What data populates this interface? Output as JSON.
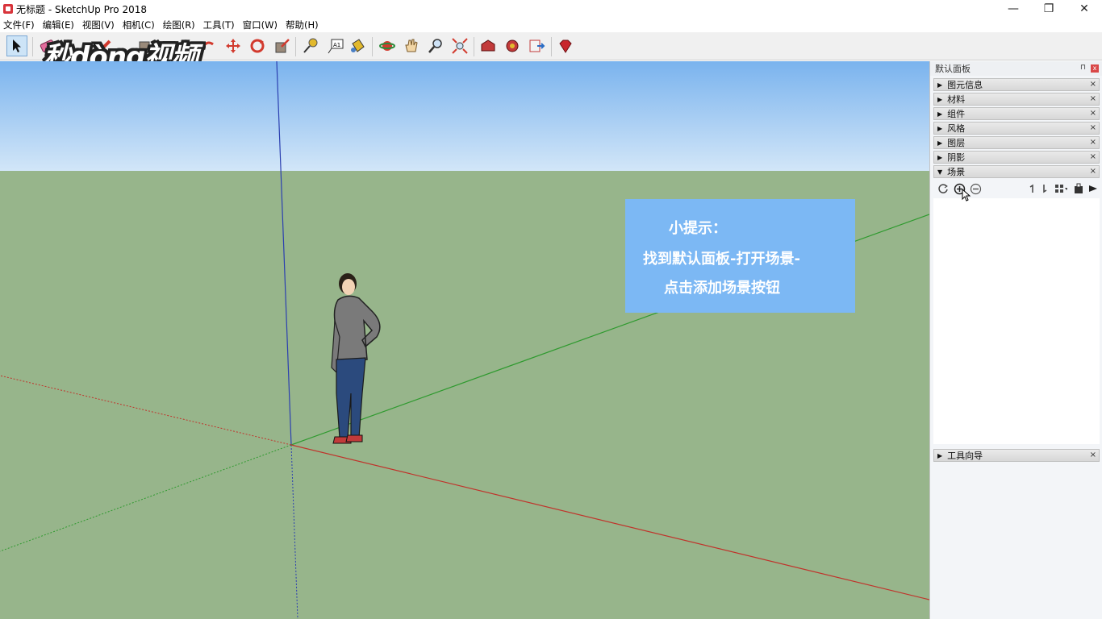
{
  "window": {
    "title": "无标题 - SketchUp Pro 2018",
    "minimize": "—",
    "maximize": "❐",
    "close": "✕"
  },
  "menu": [
    "文件(F)",
    "编辑(E)",
    "视图(V)",
    "相机(C)",
    "绘图(R)",
    "工具(T)",
    "窗口(W)",
    "帮助(H)"
  ],
  "toolbar": {
    "tools": [
      "select-icon",
      "eraser-icon",
      "pencil-icon",
      "rectangle-icon",
      "push-pull-icon",
      "follow-me-icon",
      "move-icon",
      "rotate-icon",
      "scale-icon",
      "tape-measure-icon",
      "text-icon",
      "paint-bucket-icon",
      "orbit-icon",
      "pan-icon",
      "zoom-icon",
      "zoom-extents-icon",
      "warehouse-icon",
      "extension-warehouse-icon",
      "send-to-layout-icon",
      "ruby-icon"
    ]
  },
  "watermark": {
    "text": "秒懂视频"
  },
  "tip": {
    "title": "小提示：",
    "line1": "找到默认面板-打开场景-",
    "line2": "点击添加场景按钮"
  },
  "tray": {
    "title": "默认面板",
    "pin": "⊓",
    "close": "x",
    "panels": [
      {
        "label": "图元信息",
        "expanded": false
      },
      {
        "label": "材料",
        "expanded": false
      },
      {
        "label": "组件",
        "expanded": false
      },
      {
        "label": "风格",
        "expanded": false
      },
      {
        "label": "图层",
        "expanded": false
      },
      {
        "label": "阴影",
        "expanded": false
      },
      {
        "label": "场景",
        "expanded": true
      }
    ],
    "scene_tools": [
      "refresh-icon",
      "add-scene-icon",
      "remove-scene-icon",
      "move-up-icon",
      "move-down-icon",
      "view-options-icon",
      "details-icon",
      "toggle-icon"
    ],
    "instructor": {
      "label": "工具向导"
    }
  },
  "colors": {
    "sky_top": "#7ab3ee",
    "ground": "#97b58b",
    "tip_bg": "#7cb8f4",
    "axis_red": "#c0332b",
    "axis_green": "#2f9a2f",
    "axis_blue": "#2b3fb0"
  }
}
